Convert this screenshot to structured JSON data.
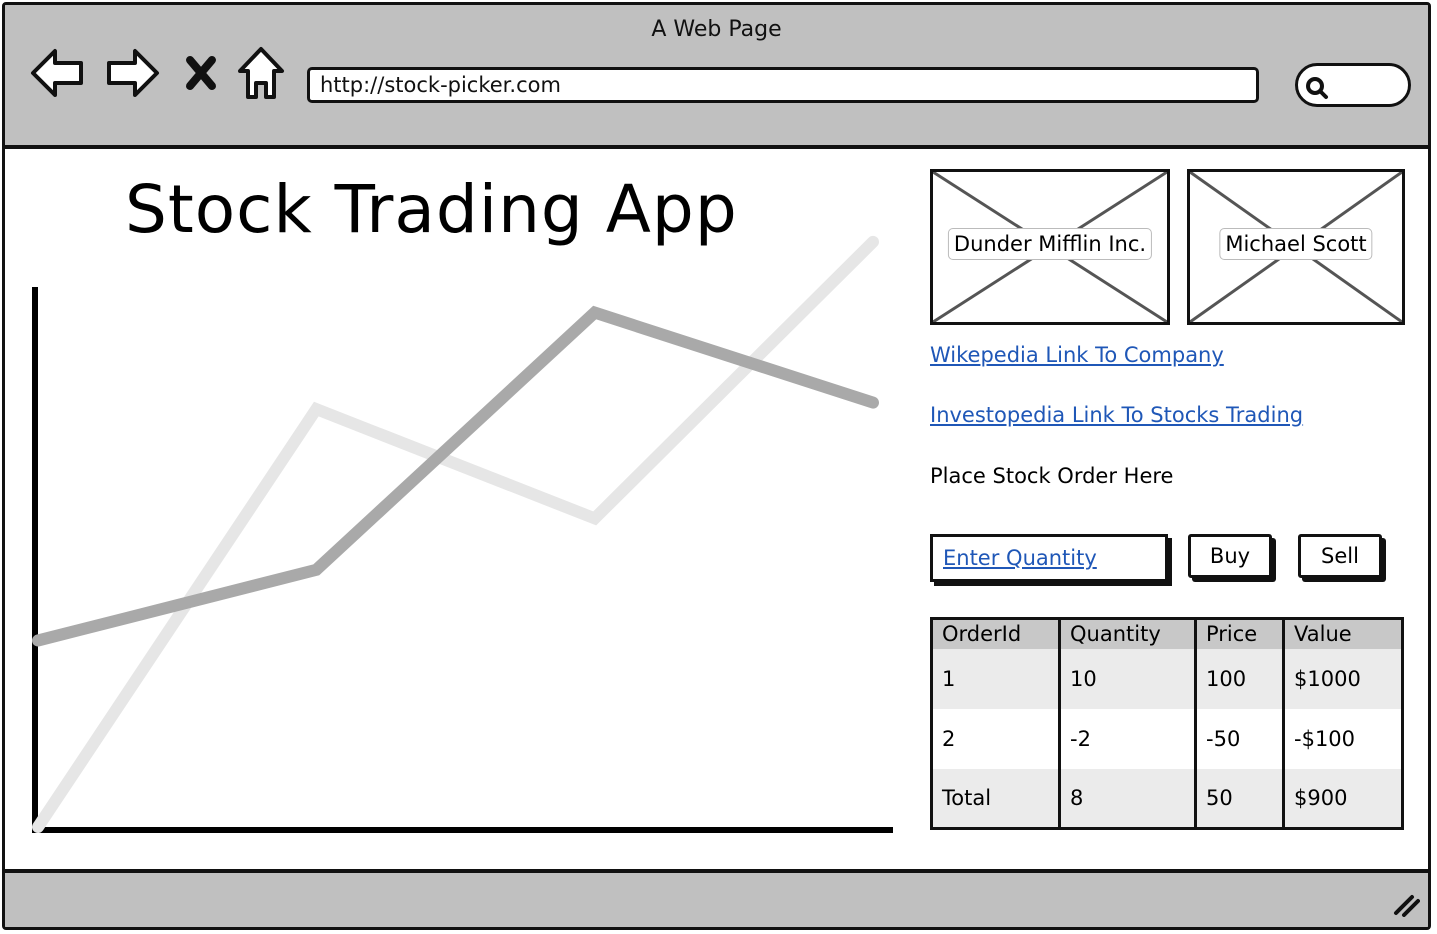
{
  "browser": {
    "window_title": "A Web Page",
    "url": "http://stock-picker.com",
    "icons": {
      "back": "arrow-left-icon",
      "forward": "arrow-right-icon",
      "stop": "close-icon",
      "home": "home-icon",
      "search": "search-icon",
      "resize": "resize-grip-icon"
    }
  },
  "page": {
    "title": "Stock Trading App",
    "images": [
      {
        "label": "Dunder Mifflin Inc."
      },
      {
        "label": "Michael Scott"
      }
    ],
    "links": [
      {
        "label": "Wikepedia Link To Company"
      },
      {
        "label": "Investopedia Link To Stocks Trading"
      }
    ],
    "order_heading": "Place Stock Order Here",
    "quantity_placeholder": "Enter Quantity",
    "buy_label": "Buy",
    "sell_label": "Sell",
    "link_color": "#1f57b7"
  },
  "orders_table": {
    "headers": [
      "OrderId",
      "Quantity",
      "Price",
      "Value"
    ],
    "rows": [
      [
        "1",
        "10",
        "100",
        "$1000"
      ],
      [
        "2",
        "-2",
        "-50",
        "-$100"
      ],
      [
        "Total",
        "8",
        "50",
        "$900"
      ]
    ]
  },
  "chart_data": {
    "type": "line",
    "title": "",
    "xlabel": "",
    "ylabel": "",
    "x": [
      0,
      1,
      2,
      3
    ],
    "ylim": [
      0,
      100
    ],
    "grid": false,
    "axes": "left-bottom",
    "series": [
      {
        "values": [
          29,
          40,
          80,
          66
        ],
        "color": "#a9a9a9"
      },
      {
        "values": [
          0,
          65,
          48,
          91
        ],
        "color": "#e6e6e6"
      }
    ]
  }
}
